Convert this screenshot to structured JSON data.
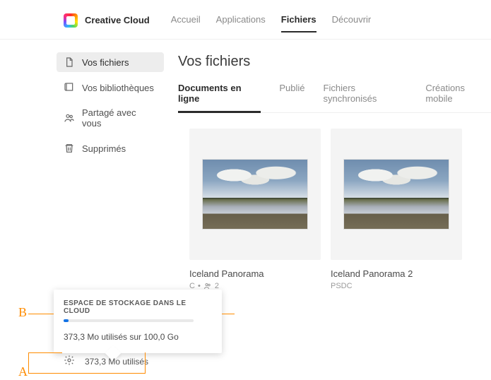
{
  "brand": {
    "name": "Creative Cloud"
  },
  "nav": [
    {
      "label": "Accueil",
      "active": false
    },
    {
      "label": "Applications",
      "active": false
    },
    {
      "label": "Fichiers",
      "active": true
    },
    {
      "label": "Découvrir",
      "active": false
    }
  ],
  "sidebar": [
    {
      "label": "Vos fichiers",
      "icon": "file-icon",
      "active": true
    },
    {
      "label": "Vos bibliothèques",
      "icon": "library-icon",
      "active": false
    },
    {
      "label": "Partagé avec vous",
      "icon": "people-icon",
      "active": false
    },
    {
      "label": "Supprimés",
      "icon": "trash-icon",
      "active": false
    }
  ],
  "page": {
    "title": "Vos fichiers"
  },
  "tabs": [
    {
      "label": "Documents en ligne",
      "active": true
    },
    {
      "label": "Publié",
      "active": false
    },
    {
      "label": "Fichiers synchronisés",
      "active": false
    },
    {
      "label": "Créations mobile",
      "active": false
    }
  ],
  "cards": [
    {
      "title": "Iceland Panorama",
      "meta_type": "C",
      "meta_sep": "•",
      "meta_count": "2"
    },
    {
      "title": "Iceland Panorama 2",
      "meta_type": "PSDC",
      "meta_sep": "",
      "meta_count": ""
    }
  ],
  "storage": {
    "popover_title": "ESPACE DE STOCKAGE DANS LE CLOUD",
    "popover_text": "373,3 Mo utilisés sur 100,0 Go",
    "footer_text": "373,3 Mo utilisés"
  },
  "annotations": {
    "A": "A",
    "B": "B"
  }
}
